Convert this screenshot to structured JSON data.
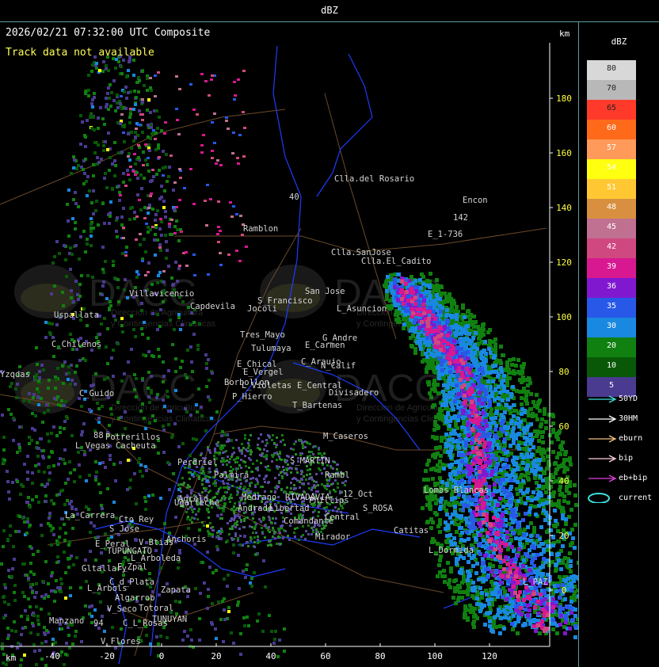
{
  "window": {
    "title": "dBZ"
  },
  "map": {
    "header": "2026/02/21 07:32:00 UTC Composite",
    "track_message": "Track data not available",
    "km_top": "km",
    "km_bottom": "km",
    "x_ticks": [
      "-40",
      "-20",
      "0",
      "20",
      "40",
      "60",
      "80",
      "100",
      "120"
    ],
    "y_ticks": [
      "180",
      "160",
      "140",
      "120",
      "100",
      "80",
      "60",
      "40",
      "20",
      "0"
    ],
    "places": [
      {
        "name": "Clla.del Rosario"
      },
      {
        "name": "Encon"
      },
      {
        "name": "142"
      },
      {
        "name": "E_1-736"
      },
      {
        "name": "Ramblon"
      },
      {
        "name": "Clla.SanJose"
      },
      {
        "name": "Clla.El_Cadito"
      },
      {
        "name": "San Jose"
      },
      {
        "name": "S_Francisco"
      },
      {
        "name": "L_Asuncion"
      },
      {
        "name": "Uspallata"
      },
      {
        "name": "Villavicencio"
      },
      {
        "name": "Capdevila"
      },
      {
        "name": "Jocoli"
      },
      {
        "name": "C_Chilenos"
      },
      {
        "name": "Tres_Mayo"
      },
      {
        "name": "Tulumaya"
      },
      {
        "name": "E_Carmen"
      },
      {
        "name": "G_Andre"
      },
      {
        "name": "E_Chical"
      },
      {
        "name": "E_Vergel"
      },
      {
        "name": "C_Araujo"
      },
      {
        "name": "N_Calif"
      },
      {
        "name": "Borbollon"
      },
      {
        "name": "L_Violetas"
      },
      {
        "name": "E_Central"
      },
      {
        "name": "Divisadero"
      },
      {
        "name": "C_Guido"
      },
      {
        "name": "P_Hierro"
      },
      {
        "name": "T_Bartenas"
      },
      {
        "name": "M_Caseros"
      },
      {
        "name": "Potrerillos"
      },
      {
        "name": "Cacheuta"
      },
      {
        "name": "L_Vegas"
      },
      {
        "name": "Perdriel"
      },
      {
        "name": "S_MARTIN"
      },
      {
        "name": "Agrelo"
      },
      {
        "name": "Palmira"
      },
      {
        "name": "Rambl"
      },
      {
        "name": "Lomas Blancas"
      },
      {
        "name": "Ugarteche"
      },
      {
        "name": "12_Oct"
      },
      {
        "name": "Medrano"
      },
      {
        "name": "RIVADAVIA"
      },
      {
        "name": "Phillips"
      },
      {
        "name": "S_ROSA"
      },
      {
        "name": "La_Carrera"
      },
      {
        "name": "Cto_Rey"
      },
      {
        "name": "S_Jose"
      },
      {
        "name": "Andrade"
      },
      {
        "name": "Libertad"
      },
      {
        "name": "Comandante"
      },
      {
        "name": "Central"
      },
      {
        "name": "Catitas"
      },
      {
        "name": "E_Peral"
      },
      {
        "name": "TUPUNGATO"
      },
      {
        "name": "V_Btias"
      },
      {
        "name": "Anchoris"
      },
      {
        "name": "Mirador"
      },
      {
        "name": "L_Dormida"
      },
      {
        "name": "L_Arboleda"
      },
      {
        "name": "Gltallary"
      },
      {
        "name": "E_Zpal"
      },
      {
        "name": "C_d_Plata"
      },
      {
        "name": "L_Arbols"
      },
      {
        "name": "Algarrob"
      },
      {
        "name": "Zapata"
      },
      {
        "name": "V_Seco"
      },
      {
        "name": "Totoral"
      },
      {
        "name": "L_PAZ"
      },
      {
        "name": "TUNUYAN"
      },
      {
        "name": "Manzano"
      },
      {
        "name": "94"
      },
      {
        "name": "C_L_Rosas"
      },
      {
        "name": "V_Flores"
      },
      {
        "name": "40"
      },
      {
        "name": "88"
      },
      {
        "name": "Yzqdas"
      }
    ],
    "watermark": {
      "text": "DACC",
      "sub1": "Direccion de Agricultura",
      "sub2": "y Contingencias Climaticas"
    }
  },
  "legend": {
    "unit": "dBZ",
    "bins": [
      {
        "label": "80",
        "color": "#d8d8d8"
      },
      {
        "label": "70",
        "color": "#b8b8b8"
      },
      {
        "label": "65",
        "color": "#ff3a2a"
      },
      {
        "label": "60",
        "color": "#ff6a1a"
      },
      {
        "label": "57",
        "color": "#ff9a5a"
      },
      {
        "label": "54",
        "color": "#ffff10"
      },
      {
        "label": "51",
        "color": "#ffc832"
      },
      {
        "label": "48",
        "color": "#d89040"
      },
      {
        "label": "45",
        "color": "#c07090"
      },
      {
        "label": "42",
        "color": "#d04880"
      },
      {
        "label": "39",
        "color": "#d81890"
      },
      {
        "label": "36",
        "color": "#8018d0"
      },
      {
        "label": "35",
        "color": "#2858e8"
      },
      {
        "label": "30",
        "color": "#1888e0"
      },
      {
        "label": "20",
        "color": "#108010"
      },
      {
        "label": "10",
        "color": "#085808"
      },
      {
        "label": "5",
        "color": "#4a3a90"
      }
    ],
    "tracks": [
      {
        "label": "50YD",
        "color": "#40e0e0"
      },
      {
        "label": "30HM",
        "color": "#ffffff"
      },
      {
        "label": "eburn",
        "color": "#f0c080"
      },
      {
        "label": "bip",
        "color": "#ffd0e0"
      },
      {
        "label": "eb+bip",
        "color": "#e040e0"
      },
      {
        "label": "current",
        "color": "#40e0e0"
      }
    ]
  }
}
